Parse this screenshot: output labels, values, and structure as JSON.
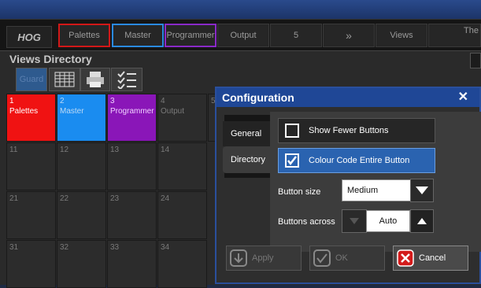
{
  "toolbar": {
    "logo": "HOG",
    "buttons": [
      "Palettes",
      "Master",
      "Programmer",
      "Output",
      "5",
      "»",
      "Views",
      "The"
    ]
  },
  "views": {
    "title": "Views Directory",
    "guard_label": "Guard",
    "cells": [
      {
        "num": "1",
        "label": "Palettes"
      },
      {
        "num": "2",
        "label": "Master"
      },
      {
        "num": "3",
        "label": "Programmer"
      },
      {
        "num": "4",
        "label": "Output"
      },
      {
        "num": "5",
        "label": ""
      },
      {
        "num": "11",
        "label": ""
      },
      {
        "num": "12",
        "label": ""
      },
      {
        "num": "13",
        "label": ""
      },
      {
        "num": "14",
        "label": ""
      },
      {
        "num": "21",
        "label": ""
      },
      {
        "num": "22",
        "label": ""
      },
      {
        "num": "23",
        "label": ""
      },
      {
        "num": "24",
        "label": ""
      },
      {
        "num": "31",
        "label": ""
      },
      {
        "num": "32",
        "label": ""
      },
      {
        "num": "33",
        "label": ""
      },
      {
        "num": "34",
        "label": ""
      }
    ],
    "colors": {
      "palettes": "#f01212",
      "master": "#1a8cf0",
      "programmer": "#8a16b8"
    }
  },
  "dialog": {
    "title": "Configuration",
    "close": "✕",
    "tabs": {
      "general": "General",
      "directory": "Directory"
    },
    "options": {
      "show_fewer": "Show Fewer Buttons",
      "colour_code": "Colour Code Entire Button"
    },
    "button_size": {
      "label": "Button size",
      "value": "Medium"
    },
    "buttons_across": {
      "label": "Buttons across",
      "value": "Auto"
    },
    "actions": {
      "apply": "Apply",
      "ok": "OK",
      "cancel": "Cancel"
    }
  }
}
